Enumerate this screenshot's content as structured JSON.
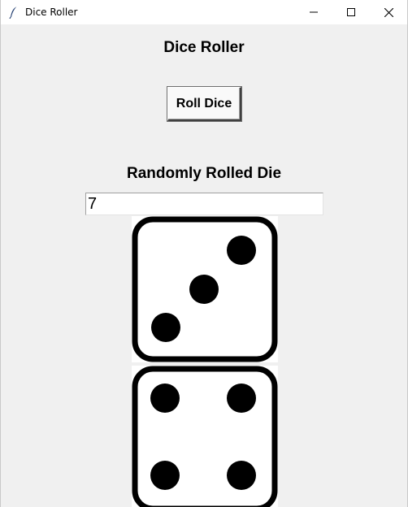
{
  "window": {
    "title": "Dice Roller",
    "controls": [
      "minimize-icon",
      "maximize-icon",
      "close-icon"
    ]
  },
  "main": {
    "heading": "Dice Roller",
    "roll_button_label": "Roll Dice",
    "result_heading": "Randomly Rolled Die",
    "result_value": "7"
  },
  "dice": [
    {
      "face": 3,
      "icon": "die-face-three-icon"
    },
    {
      "face": 4,
      "icon": "die-face-four-icon"
    }
  ],
  "colors": {
    "background": "#f0f0f0",
    "titlebar": "#ffffff",
    "pip": "#000000"
  }
}
